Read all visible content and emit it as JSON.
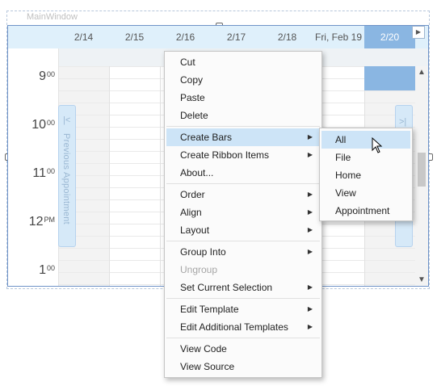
{
  "window": {
    "title": "MainWindow"
  },
  "scheduler": {
    "dates": [
      {
        "label": "2/14",
        "selected": false
      },
      {
        "label": "2/15",
        "selected": false
      },
      {
        "label": "2/16",
        "selected": false
      },
      {
        "label": "2/17",
        "selected": false
      },
      {
        "label": "2/18",
        "selected": false
      },
      {
        "label": "Fri, Feb 19",
        "selected": false
      },
      {
        "label": "2/20",
        "selected": true
      }
    ],
    "times": [
      {
        "h": "9",
        "m": "00"
      },
      {
        "h": "10",
        "m": "00"
      },
      {
        "h": "11",
        "m": "00"
      },
      {
        "h": "12",
        "m": "PM"
      },
      {
        "h": "1",
        "m": "00"
      }
    ],
    "previous_appointment": "Previous Appointment",
    "accent_color": "#8ab6e2",
    "header_bg": "#dff0fb"
  },
  "context_menu": {
    "items": [
      {
        "label": "Cut",
        "submenu": false,
        "disabled": false
      },
      {
        "label": "Copy",
        "submenu": false,
        "disabled": false
      },
      {
        "label": "Paste",
        "submenu": false,
        "disabled": false
      },
      {
        "label": "Delete",
        "submenu": false,
        "disabled": false
      },
      {
        "label": "Create Bars",
        "submenu": true,
        "disabled": false,
        "highlighted": true
      },
      {
        "label": "Create Ribbon Items",
        "submenu": true,
        "disabled": false
      },
      {
        "label": "About...",
        "submenu": false,
        "disabled": false
      },
      {
        "label": "Order",
        "submenu": true,
        "disabled": false
      },
      {
        "label": "Align",
        "submenu": true,
        "disabled": false
      },
      {
        "label": "Layout",
        "submenu": true,
        "disabled": false
      },
      {
        "label": "Group Into",
        "submenu": true,
        "disabled": false
      },
      {
        "label": "Ungroup",
        "submenu": false,
        "disabled": true
      },
      {
        "label": "Set Current Selection",
        "submenu": true,
        "disabled": false
      },
      {
        "label": "Edit Template",
        "submenu": true,
        "disabled": false
      },
      {
        "label": "Edit Additional Templates",
        "submenu": true,
        "disabled": false
      },
      {
        "label": "View Code",
        "submenu": false,
        "disabled": false
      },
      {
        "label": "View Source",
        "submenu": false,
        "disabled": false
      }
    ]
  },
  "submenu": {
    "items": [
      {
        "label": "All",
        "highlighted": true
      },
      {
        "label": "File",
        "highlighted": false
      },
      {
        "label": "Home",
        "highlighted": false
      },
      {
        "label": "View",
        "highlighted": false
      },
      {
        "label": "Appointment",
        "highlighted": false
      }
    ]
  }
}
